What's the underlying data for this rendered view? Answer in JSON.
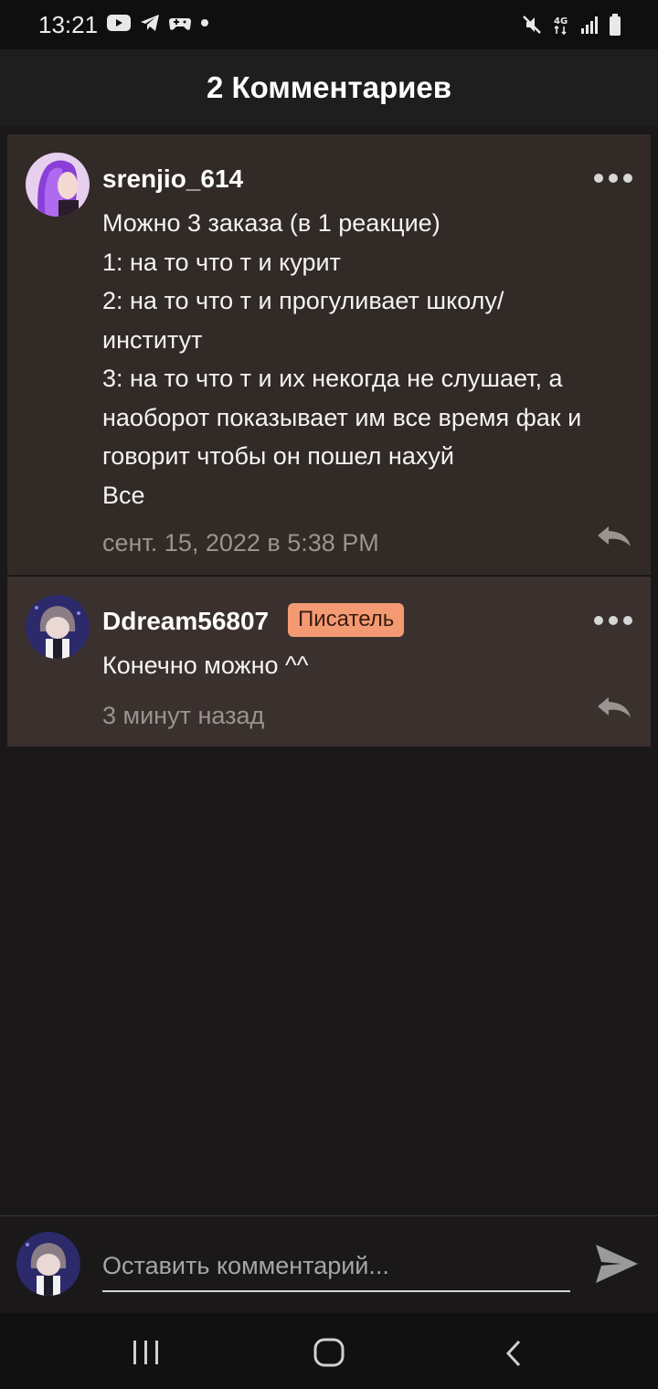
{
  "status_bar": {
    "time": "13:21",
    "icons": [
      "youtube-icon",
      "telegram-icon",
      "gamepad-icon",
      "dot-icon",
      "mute-icon",
      "4g-icon",
      "signal-icon",
      "battery-icon"
    ],
    "network_label": "4G"
  },
  "header": {
    "title": "2 Комментариев"
  },
  "comments": [
    {
      "username": "srenjio_614",
      "text": "Можно 3 заказа (в 1 реакцие)\n1: на то что т и курит\n2: на то что т и прогуливает школу/\nинститут\n3: на то что т и их некогда не слушает, а\nнаоборот показывает им все время фак и\nговорит чтобы он пошел нахуй\nВсе",
      "timestamp": "сент. 15, 2022 в 5:38 PM"
    },
    {
      "username": "Ddream56807",
      "badge": "Писатель",
      "text": "Конечно можно ^^",
      "timestamp": "3 минут назад"
    }
  ],
  "composer": {
    "placeholder": "Оставить комментарий..."
  },
  "colors": {
    "background": "#1a1819",
    "card": "#312a26",
    "badge": "#f49a73",
    "muted_text": "#9b938f"
  }
}
